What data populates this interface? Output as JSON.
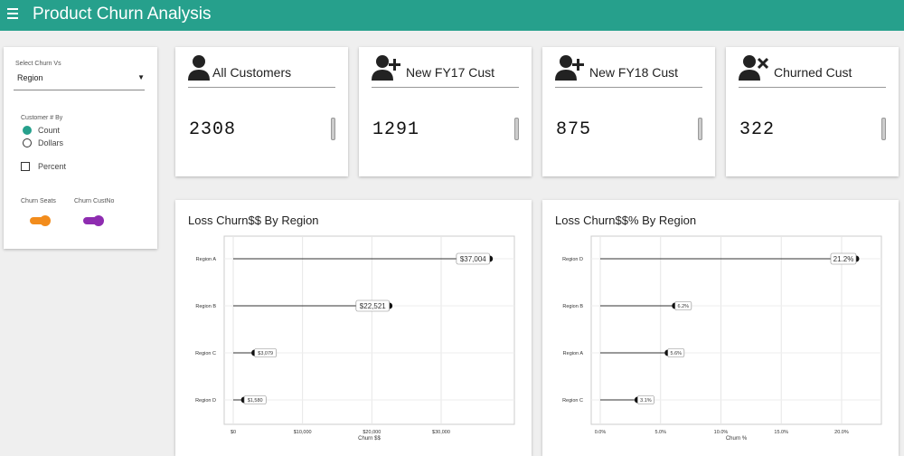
{
  "header": {
    "title": "Product Churn Analysis",
    "menu_icon": "hamburger-menu-icon",
    "color": "#26a08c"
  },
  "sidebar": {
    "select_label": "Select Churn Vs",
    "select_value": "Region",
    "customer_by_label": "Customer # By",
    "radio_options": [
      {
        "label": "Count",
        "selected": true
      },
      {
        "label": "Dollars",
        "selected": false
      }
    ],
    "percent_label": "Percent",
    "toggles": [
      {
        "label": "Churn Seats",
        "color": "#f28c1c"
      },
      {
        "label": "Churn CustNo",
        "color": "#8e2cb0"
      }
    ]
  },
  "stats": [
    {
      "title": "All Customers",
      "value": "2308",
      "icon": "person-icon"
    },
    {
      "title": "New FY17 Cust",
      "value": "1291",
      "icon": "person-add-icon"
    },
    {
      "title": "New FY18 Cust",
      "value": "875",
      "icon": "person-add-icon"
    },
    {
      "title": "Churned Cust",
      "value": "322",
      "icon": "person-remove-icon"
    }
  ],
  "charts": [
    {
      "title": "Loss Churn$$ By Region"
    },
    {
      "title": "Loss Churn$$% By Region"
    }
  ],
  "chart_data": [
    {
      "type": "bar",
      "title": "Loss Churn$$ By Region",
      "xlabel": "Churn $$",
      "ylabel": "",
      "categories": [
        "Region A",
        "Region B",
        "Region C",
        "Region D"
      ],
      "values": [
        37004,
        22521,
        3079,
        1580
      ],
      "value_labels": [
        "$37,004",
        "$22,521",
        "$3,079",
        "$1,580"
      ],
      "xlim": [
        0,
        39000
      ],
      "xticks": [
        0,
        10000,
        20000,
        30000
      ],
      "xtick_labels": [
        "$0",
        "$10,000",
        "$20,000",
        "$30,000"
      ],
      "grid": true
    },
    {
      "type": "bar",
      "title": "Loss Churn$$% By Region",
      "xlabel": "Churn %",
      "ylabel": "",
      "categories": [
        "Region D",
        "Region B",
        "Region A",
        "Region C"
      ],
      "values": [
        21.2,
        6.2,
        5.6,
        3.1
      ],
      "value_labels": [
        "21.2%",
        "6.2%",
        "5.6%",
        "3.1%"
      ],
      "xlim": [
        0,
        22.4
      ],
      "xticks": [
        0,
        5,
        10,
        15,
        20
      ],
      "xtick_labels": [
        "0.0%",
        "5.0%",
        "10.0%",
        "15.0%",
        "20.0%"
      ],
      "grid": true
    }
  ]
}
